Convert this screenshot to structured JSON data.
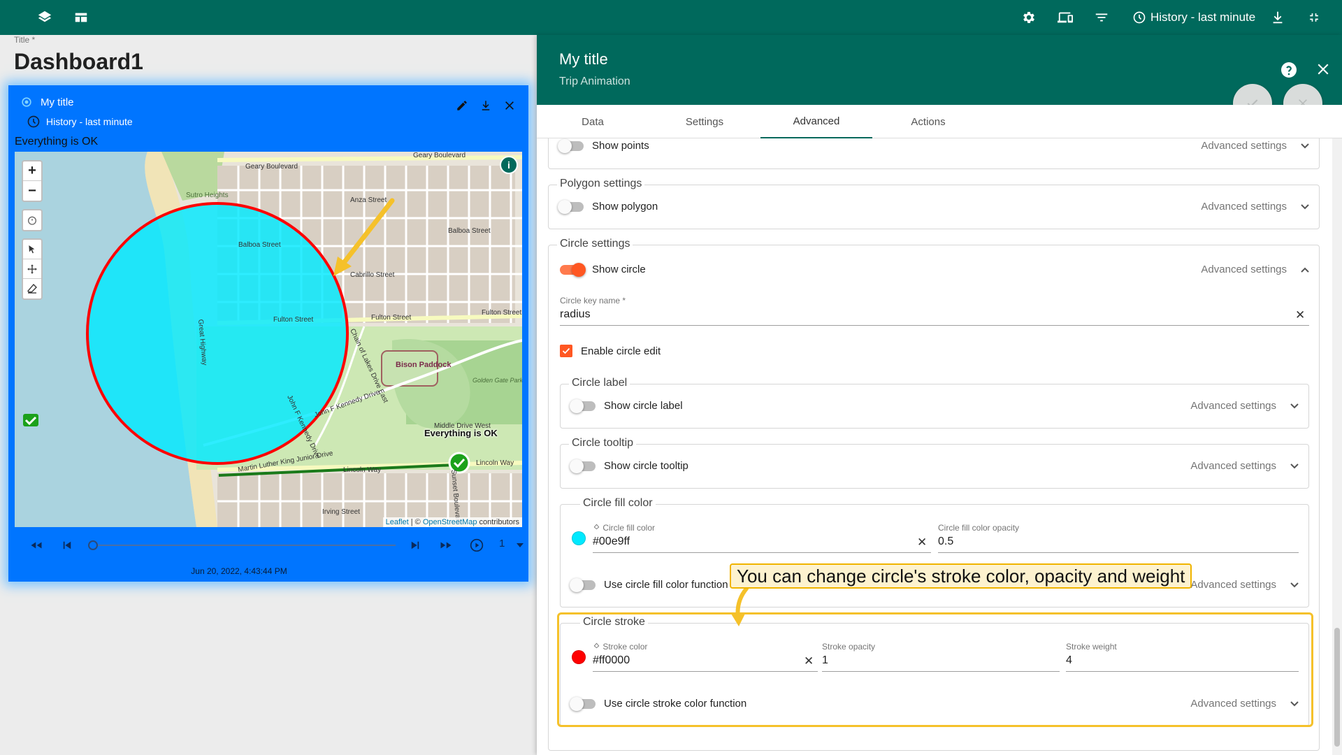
{
  "topbar": {
    "left_icons": [
      "layers-icon",
      "dashboard-layout-icon"
    ],
    "right_icons": [
      "settings-icon",
      "devices-icon",
      "filter-icon",
      "download-icon",
      "fullscreen-exit-icon"
    ],
    "history_label": "History - last minute"
  },
  "dashboard": {
    "title_label": "Title *",
    "title": "Dashboard1"
  },
  "widget": {
    "title": "My title",
    "timewindow": "History - last minute",
    "status_text": "Everything is OK",
    "map": {
      "zoom_in": "+",
      "zoom_out": "−",
      "streets": [
        "Geary Boulevard",
        "Geary Boulevard",
        "Anza Street",
        "Balboa Street",
        "Balboa Street",
        "Cabrillo Street",
        "Fulton Street",
        "Fulton Street",
        "Fulton Street",
        "Lincoln Way",
        "Lincoln Way",
        "Sutro Heights",
        "Great Highway",
        "John F Kennedy Drive",
        "Martin Luther King Junior Drive",
        "Chain of Lakes Drive East",
        "Irving Street",
        "Sunset Boulevard",
        "John F Kennedy Drive",
        "Middle Drive West"
      ],
      "places": [
        "Bison Paddock",
        "Golden Gate Park Polo Field and Stadium"
      ],
      "marker_label": "Everything is OK",
      "attribution_leaflet": "Leaflet",
      "attribution_sep": " | © ",
      "attribution_osm": "OpenStreetMap",
      "attribution_tail": " contributors",
      "circle_fill": "#00e9ff",
      "circle_stroke": "#ff0000"
    },
    "player": {
      "timestamp": "Jun 20, 2022, 4:43:44 PM",
      "speed": "1",
      "progress": 0.0
    }
  },
  "panel": {
    "title": "My title",
    "subtitle": "Trip Animation",
    "tabs": [
      {
        "label": "Data",
        "active": false
      },
      {
        "label": "Settings",
        "active": false
      },
      {
        "label": "Advanced",
        "active": true
      },
      {
        "label": "Actions",
        "active": false
      }
    ],
    "advanced_settings_label": "Advanced settings",
    "points": {
      "toggle_label": "Show points",
      "on": false
    },
    "polygon": {
      "legend": "Polygon settings",
      "toggle_label": "Show polygon",
      "on": false
    },
    "circle": {
      "legend": "Circle settings",
      "toggle_label": "Show circle",
      "on": true,
      "key_name_label": "Circle key name *",
      "key_name_value": "radius",
      "enable_edit_label": "Enable circle edit",
      "enable_edit_checked": true,
      "label": {
        "legend": "Circle label",
        "toggle_label": "Show circle label"
      },
      "tooltip": {
        "legend": "Circle tooltip",
        "toggle_label": "Show circle tooltip"
      },
      "fill": {
        "legend": "Circle fill color",
        "color_label": "Circle fill color",
        "color_value": "#00e9ff",
        "opacity_label": "Circle fill color opacity",
        "opacity_value": "0.5",
        "function_label": "Use circle fill color function"
      },
      "stroke": {
        "legend": "Circle stroke",
        "color_label": "Stroke color",
        "color_value": "#ff0000",
        "opacity_label": "Stroke opacity",
        "opacity_value": "1",
        "weight_label": "Stroke weight",
        "weight_value": "4",
        "function_label": "Use circle stroke color function"
      }
    }
  },
  "tutorial": {
    "callout_text": "You can change circle's stroke color, opacity and weight"
  },
  "colors": {
    "brand": "#00695c",
    "widget_bg": "#0075ff",
    "accent": "#ff5722",
    "highlight": "#f5c12a"
  }
}
